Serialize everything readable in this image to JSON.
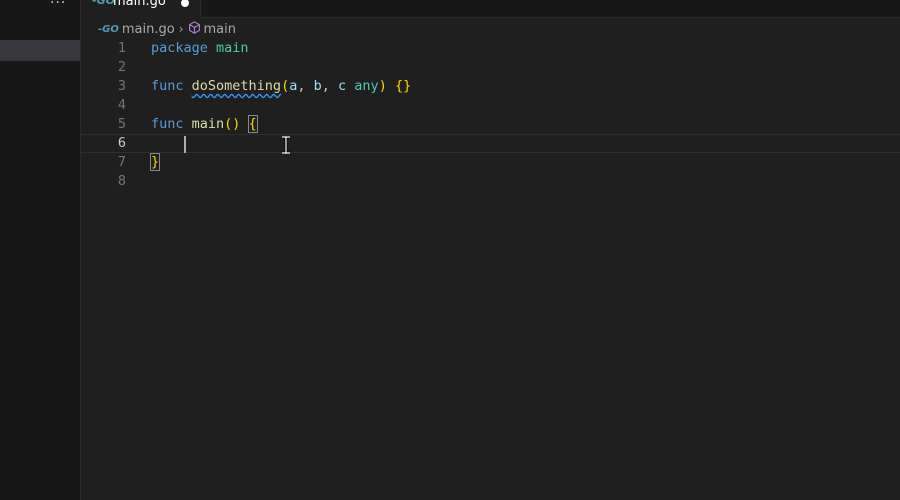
{
  "sidebar": {
    "more_label": "..."
  },
  "tab": {
    "label": "main.go",
    "icon": "go-file-icon"
  },
  "breadcrumb": {
    "file": "main.go",
    "separator": "›",
    "symbol": "main"
  },
  "editor": {
    "lines": [
      {
        "number": "1",
        "t": [
          "package",
          " ",
          "main"
        ]
      },
      {
        "number": "2"
      },
      {
        "number": "3",
        "t": [
          "func",
          " ",
          "doSomething",
          "(",
          "a",
          ", ",
          "b",
          ", ",
          "c",
          " ",
          "any",
          ")",
          " ",
          "{}"
        ]
      },
      {
        "number": "4"
      },
      {
        "number": "5",
        "t": [
          "func",
          " ",
          "main",
          "()",
          " ",
          "{"
        ]
      },
      {
        "number": "6"
      },
      {
        "number": "7",
        "t": [
          "}"
        ]
      },
      {
        "number": "8"
      }
    ],
    "current_line": 6
  },
  "colors": {
    "keyword": "#569cd6",
    "function": "#dcdcaa",
    "param": "#9cdcfe",
    "type": "#4ec9b0",
    "bracket": "#ffd700",
    "background": "#1f1f1f"
  }
}
